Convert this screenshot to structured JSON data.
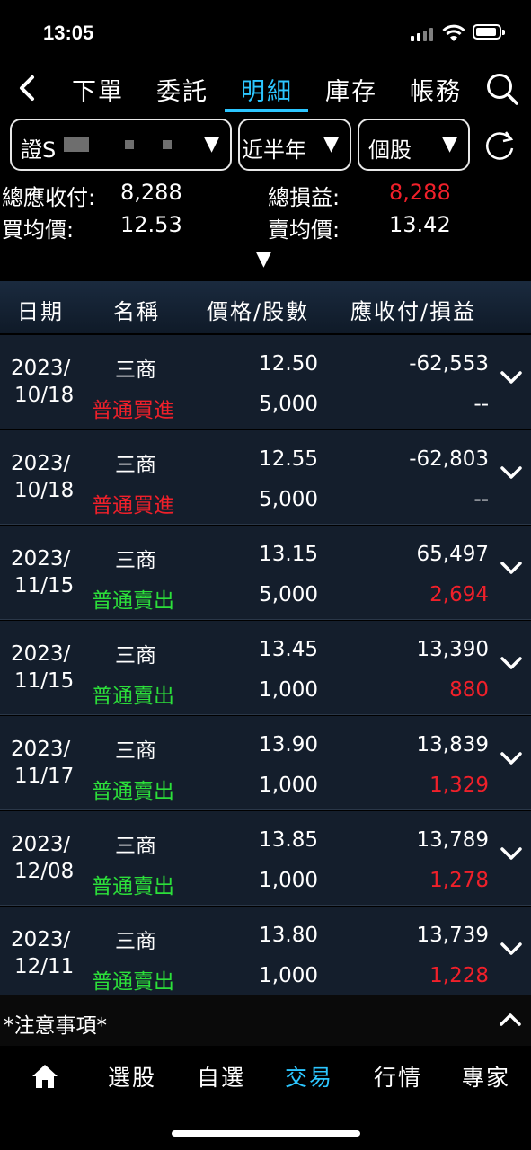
{
  "status": {
    "time": "13:05"
  },
  "nav": {
    "tabs": [
      {
        "label": "下單"
      },
      {
        "label": "委託"
      },
      {
        "label": "明細"
      },
      {
        "label": "庫存"
      },
      {
        "label": "帳務"
      }
    ],
    "active_tab": "明細"
  },
  "filters": {
    "account": "證S",
    "period": "近半年",
    "type": "個股"
  },
  "summary": {
    "total_receivable_label": "總應收付:",
    "total_receivable": "8,288",
    "total_pnl_label": "總損益:",
    "total_pnl": "8,288",
    "avg_buy_label": "買均價:",
    "avg_buy": "12.53",
    "avg_sell_label": "賣均價:",
    "avg_sell": "13.42"
  },
  "table": {
    "headers": {
      "date": "日期",
      "name": "名稱",
      "price_qty": "價格/股數",
      "amount_pnl": "應收付/損益"
    },
    "rows": [
      {
        "year": "2023/",
        "md": "10/18",
        "name": "三商",
        "action": "普通買進",
        "price": "12.50",
        "qty": "5,000",
        "amount": "-62,553",
        "pnl": "--"
      },
      {
        "year": "2023/",
        "md": "10/18",
        "name": "三商",
        "action": "普通買進",
        "price": "12.55",
        "qty": "5,000",
        "amount": "-62,803",
        "pnl": "--"
      },
      {
        "year": "2023/",
        "md": "11/15",
        "name": "三商",
        "action": "普通賣出",
        "price": "13.15",
        "qty": "5,000",
        "amount": "65,497",
        "pnl": "2,694"
      },
      {
        "year": "2023/",
        "md": "11/15",
        "name": "三商",
        "action": "普通賣出",
        "price": "13.45",
        "qty": "1,000",
        "amount": "13,390",
        "pnl": "880"
      },
      {
        "year": "2023/",
        "md": "11/17",
        "name": "三商",
        "action": "普通賣出",
        "price": "13.90",
        "qty": "1,000",
        "amount": "13,839",
        "pnl": "1,329"
      },
      {
        "year": "2023/",
        "md": "12/08",
        "name": "三商",
        "action": "普通賣出",
        "price": "13.85",
        "qty": "1,000",
        "amount": "13,789",
        "pnl": "1,278"
      },
      {
        "year": "2023/",
        "md": "12/11",
        "name": "三商",
        "action": "普通賣出",
        "price": "13.80",
        "qty": "1,000",
        "amount": "13,739",
        "pnl": "1,228"
      }
    ]
  },
  "notice": {
    "label": "*注意事項*"
  },
  "bottom_nav": {
    "items": [
      {
        "label": "選股"
      },
      {
        "label": "自選"
      },
      {
        "label": "交易"
      },
      {
        "label": "行情"
      },
      {
        "label": "專家"
      }
    ],
    "active": "交易"
  },
  "colors": {
    "accent": "#2cc6ff",
    "buy": "#f0202a",
    "sell": "#2cdf3a",
    "profit": "#f0202a"
  }
}
